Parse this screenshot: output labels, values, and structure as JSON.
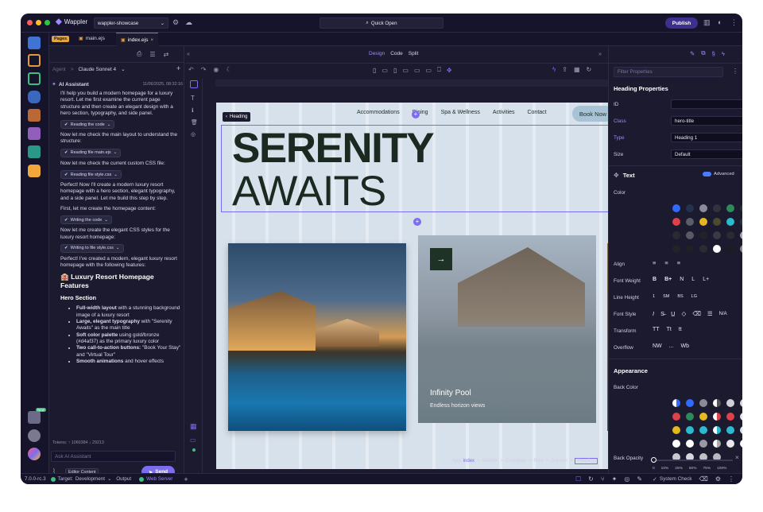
{
  "app": {
    "name": "Wappler",
    "project": "wappler-showcase",
    "search": "Quick Open",
    "publish": "Publish"
  },
  "tabs": [
    {
      "label": "Pages"
    },
    {
      "label": "main.ejs"
    },
    {
      "label": "index.ejs"
    }
  ],
  "chat": {
    "agent_label": "Agent",
    "model": "Claude Sonnet 4",
    "assistant_name": "AI Assistant",
    "timestamp": "11/06/2025, 08:32:16",
    "p1": "I'll help you build a modern homepage for a luxury resort. Let me first examine the current page structure and then create an elegant design with a hero section, typography, and side panel.",
    "step1": "Reading the code",
    "p2": "Now let me check the main layout to understand the structure:",
    "step2": "Reading file main.ejs",
    "p3": "Now let me check the current custom CSS file:",
    "step3": "Reading file style.css",
    "p4": "Perfect! Now I'll create a modern luxury resort homepage with a hero section, elegant typography, and a side panel. Let me build this step by step.",
    "p5": "First, let me create the homepage content:",
    "step4": "Writing the code",
    "p6": "Now let me create the elegant CSS styles for the luxury resort homepage:",
    "step5": "Writing to file style.css",
    "p7": "Perfect! I've created a modern, elegant luxury resort homepage with the following features:",
    "h1": "🏨 Luxury Resort Homepage Features",
    "h2": "Hero Section",
    "bullets": [
      {
        "b": "Full-width layout",
        "t": " with a stunning background image of a luxury resort"
      },
      {
        "b": "Large, elegant typography",
        "t": " with \"Serenity Awaits\" as the main title"
      },
      {
        "b": "Soft color palette",
        "t": " using gold/bronze (#d4af37) as the primary luxury color"
      },
      {
        "b": "Two call-to-action buttons:",
        "t": " \"Book Your Stay\" and \"Virtual Tour\""
      },
      {
        "b": "Smooth animations",
        "t": " and hover effects"
      }
    ],
    "tokens": "Tokens: ↑ 1060384 ↓ 29213",
    "input_placeholder": "Ask AI Assistant",
    "editor_content": "Editor Content",
    "send": "Send",
    "badge_new": "New"
  },
  "canvas": {
    "modes": [
      "Design",
      "Code",
      "Split"
    ],
    "heading_tag": "Heading",
    "nav": [
      "Accommodations",
      "Dining",
      "Spa & Wellness",
      "Activities",
      "Contact"
    ],
    "book": "Book Now",
    "title1": "SERENITY",
    "title2": "AWAITS",
    "card_title": "Infinity Pool",
    "card_sub": "Endless horizon views",
    "breadcrumb": [
      "App",
      "index",
      ">",
      "Section",
      ">",
      "Container",
      ">",
      "Row",
      ">",
      "Column",
      ">",
      "Heading"
    ]
  },
  "props": {
    "filter_placeholder": "Filter Properties",
    "section": "Heading Properties",
    "id_label": "ID",
    "class_label": "Class",
    "class_value": "hero-title",
    "type_label": "Type",
    "type_value": "Heading 1",
    "size_label": "Size",
    "size_value": "Default",
    "text_section": "Text",
    "advanced": "Advanced",
    "color_label": "Color",
    "align_label": "Align",
    "fw_label": "Font Weight",
    "fw": [
      "B",
      "B+",
      "N",
      "L",
      "L+"
    ],
    "lh_label": "Line Height",
    "lh": [
      "1",
      "SM",
      "BS",
      "LG"
    ],
    "fs_label": "Font Style",
    "fs_na": "N/A",
    "tf_label": "Transform",
    "tf": [
      "TT",
      "Tt",
      "tt"
    ],
    "of_label": "Overflow",
    "of": [
      "NW",
      "...",
      "Wb"
    ],
    "appearance": "Appearance",
    "bg_label": "Back Color",
    "opacity_label": "Back Opacity",
    "opacity_ticks": [
      "0",
      "10%",
      "25%",
      "50%",
      "75%",
      "100%"
    ]
  },
  "status": {
    "version": "7.0.0-rc.3",
    "target_label": "Target:",
    "target": "Development",
    "output": "Output",
    "server": "Web Server",
    "syscheck": "System Check"
  },
  "colors": {
    "accent": "#7c6cf0",
    "window": "#1b1a2e",
    "dark_green": "#1e3326"
  }
}
